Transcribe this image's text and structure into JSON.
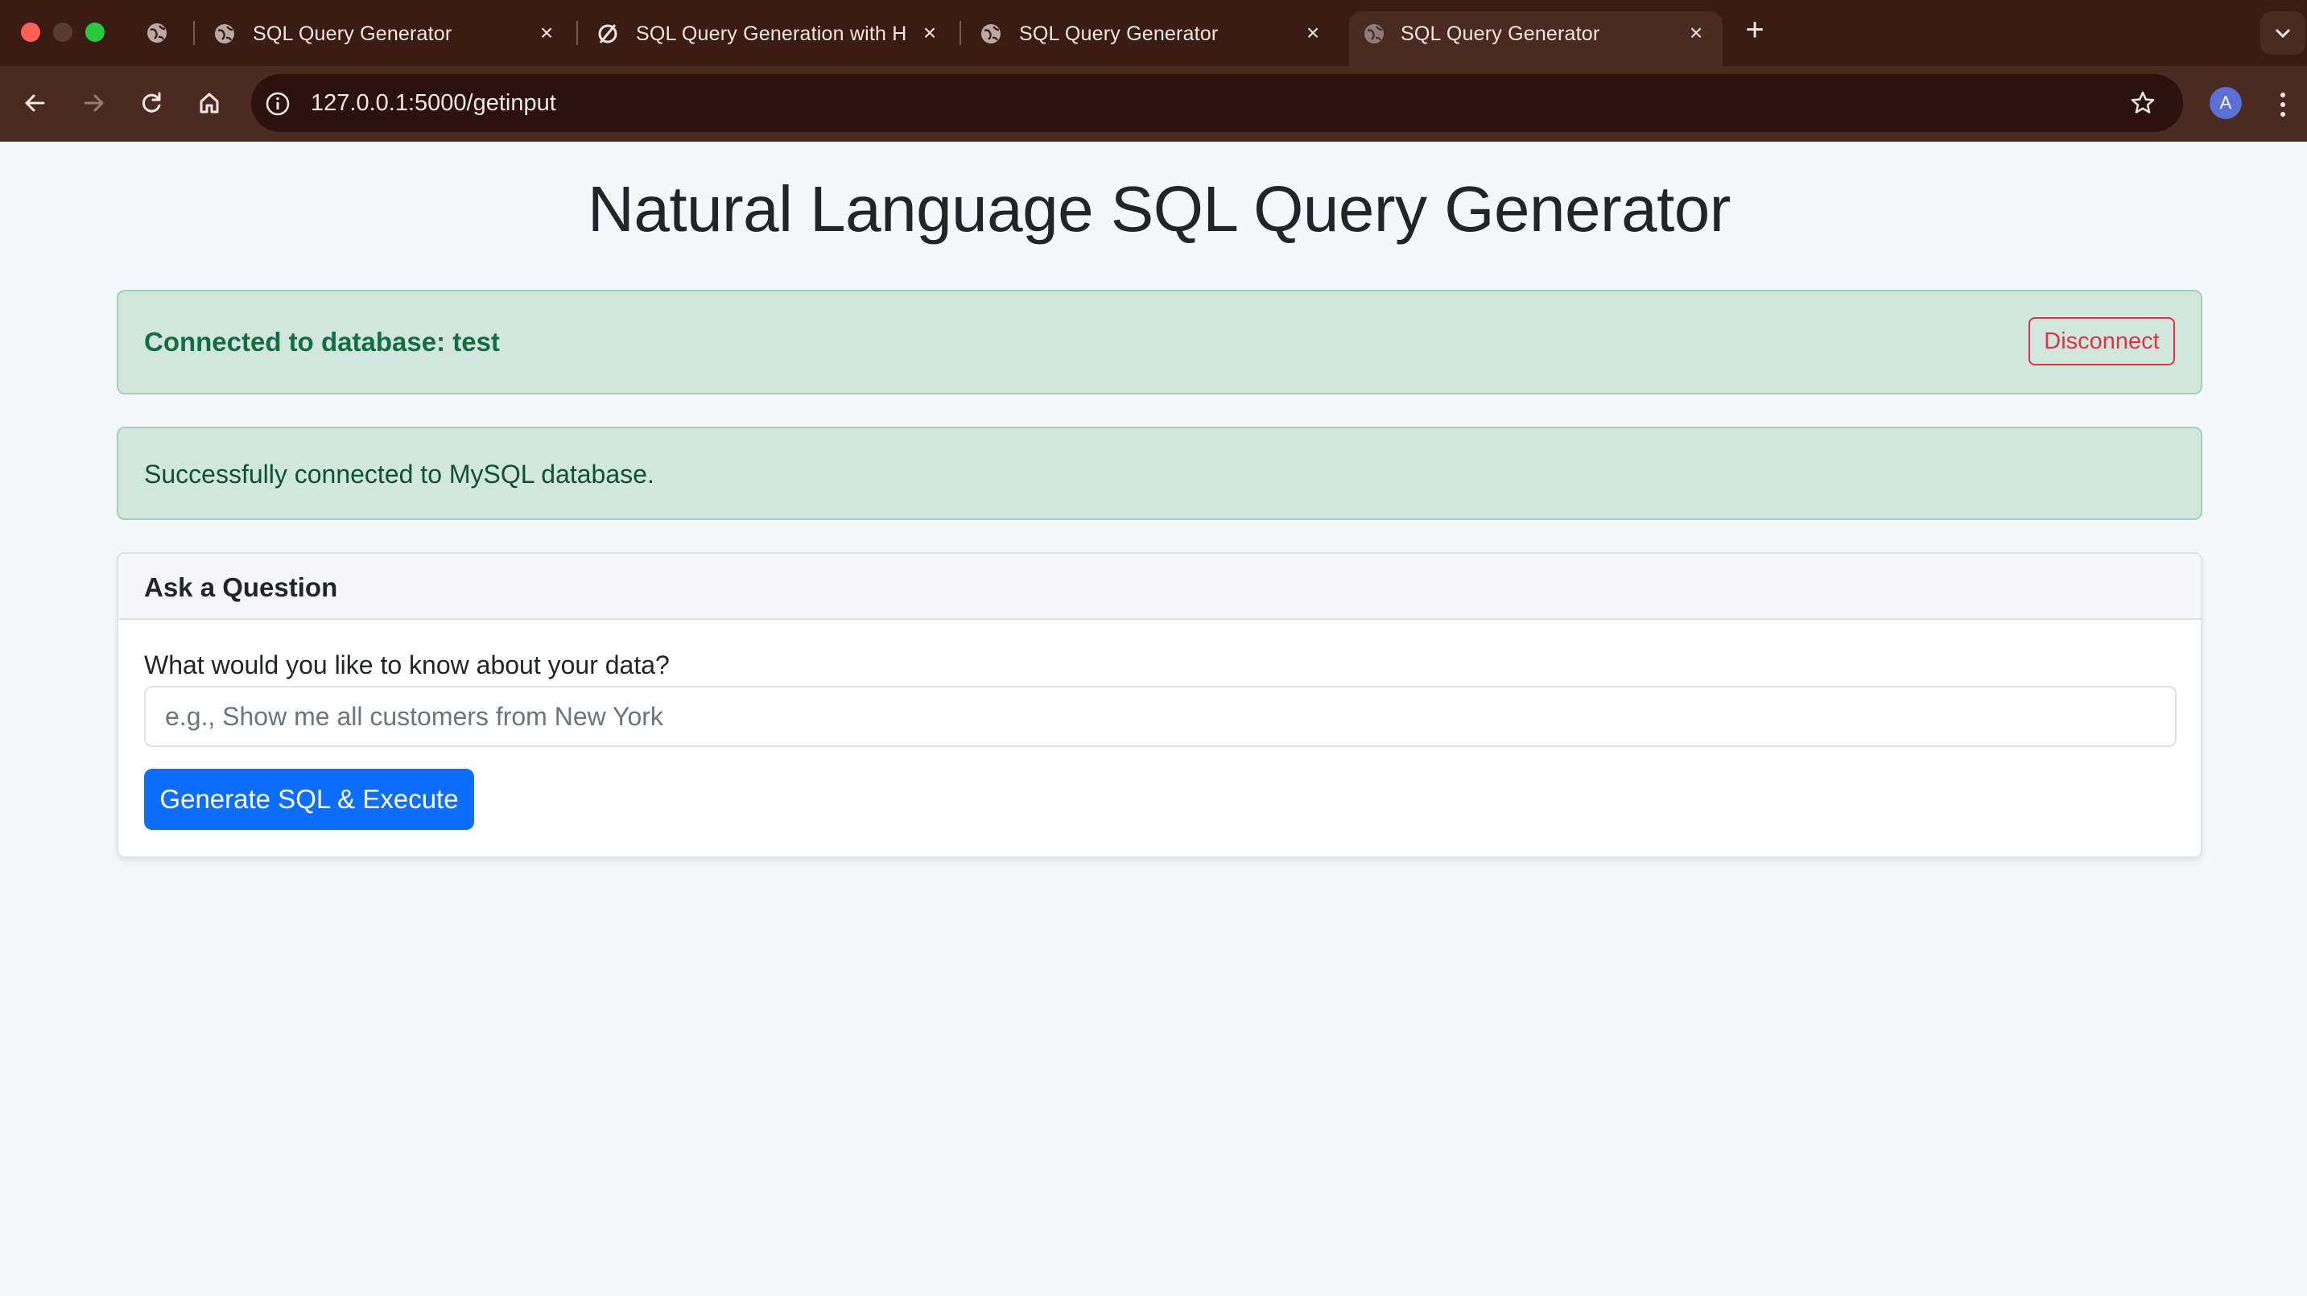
{
  "browser": {
    "tabs": [
      {
        "title": "SQL Query Generator",
        "active": false
      },
      {
        "title": "SQL Query Generation with H",
        "active": false
      },
      {
        "title": "SQL Query Generator",
        "active": false
      },
      {
        "title": "SQL Query Generator",
        "active": true
      }
    ],
    "url": "127.0.0.1:5000/getinput",
    "profile_initial": "A"
  },
  "page": {
    "title": "Natural Language SQL Query Generator",
    "connection": {
      "label": "Connected to database: test",
      "disconnect_label": "Disconnect"
    },
    "flash_message": "Successfully connected to MySQL database.",
    "question_card": {
      "header": "Ask a Question",
      "field_label": "What would you like to know about your data?",
      "input_value": "",
      "input_placeholder": "e.g., Show me all customers from New York",
      "submit_label": "Generate SQL & Execute"
    }
  },
  "colors": {
    "tab_bar": "#3a1c14",
    "toolbar": "#4a2a21",
    "success_bg": "#d1e7dd",
    "success_text": "#146c43",
    "danger": "#dc3545",
    "primary": "#0d6efd"
  }
}
